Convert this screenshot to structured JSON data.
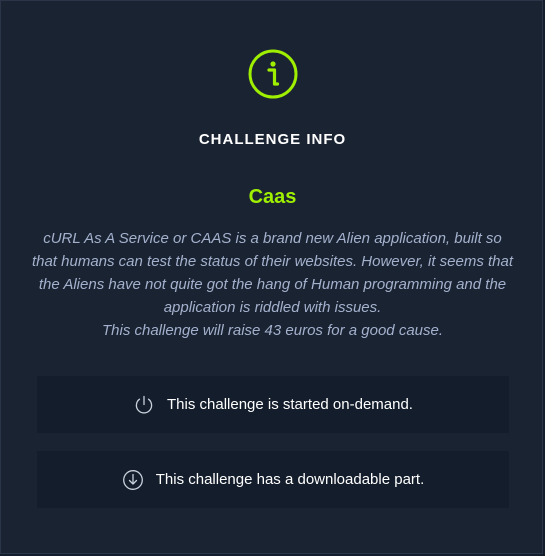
{
  "header": {
    "title": "CHALLENGE INFO",
    "icon": "info-icon"
  },
  "challenge": {
    "name": "Caas",
    "description": "cURL As A Service or CAAS is a brand new Alien application, built so that humans can test the status of their websites. However, it seems that the Aliens have not quite got the hang of Human programming and the application is riddled with issues.",
    "charity_note": "This challenge will raise 43 euros for a good cause."
  },
  "features": [
    {
      "icon": "power-icon",
      "text": "This challenge is started on-demand."
    },
    {
      "icon": "download-icon",
      "text": "This challenge has a downloadable part."
    }
  ],
  "colors": {
    "accent": "#9fef00",
    "panel_bg": "#1a2332",
    "box_bg": "#141d2b",
    "text_muted": "#a4b1cd"
  }
}
